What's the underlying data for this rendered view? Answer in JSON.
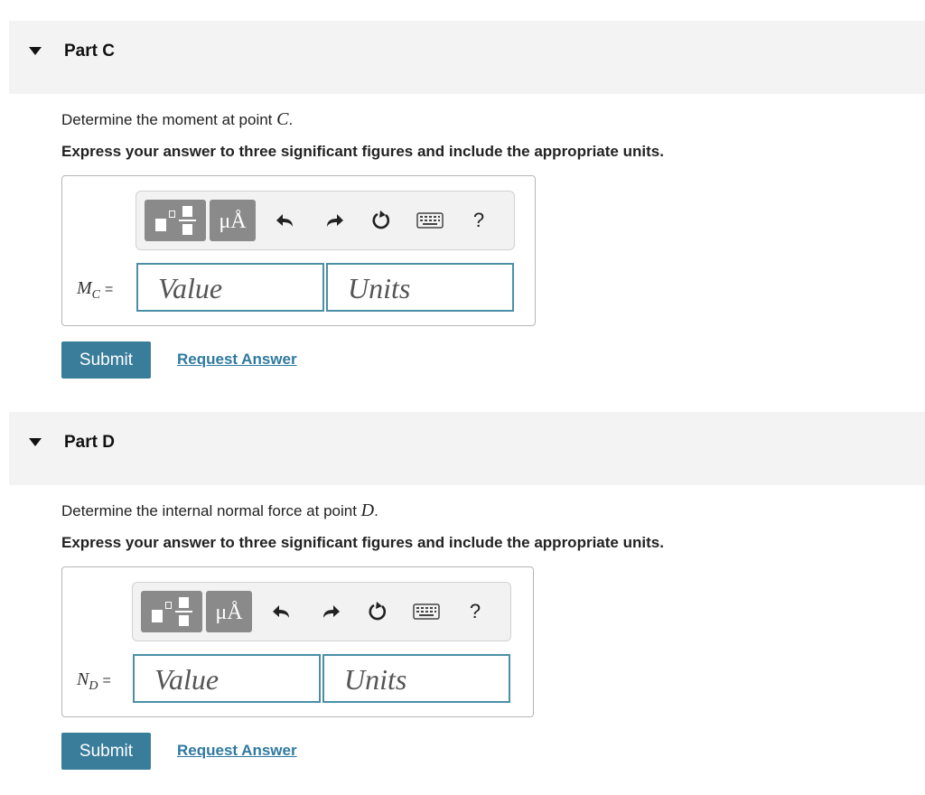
{
  "parts": [
    {
      "header": "Part C",
      "prompt_prefix": "Determine the moment at point ",
      "prompt_var": "C",
      "prompt_suffix": ".",
      "instructions": "Express your answer to three significant figures and include the appropriate units.",
      "var_main": "M",
      "var_sub": "C",
      "equals": "=",
      "value_placeholder": "Value",
      "units_placeholder": "Units",
      "units_button": "μÅ",
      "help_label": "?",
      "submit_label": "Submit",
      "request_label": "Request Answer"
    },
    {
      "header": "Part D",
      "prompt_prefix": "Determine the internal normal force at point ",
      "prompt_var": "D",
      "prompt_suffix": ".",
      "instructions": "Express your answer to three significant figures and include the appropriate units.",
      "var_main": "N",
      "var_sub": "D",
      "equals": "=",
      "value_placeholder": "Value",
      "units_placeholder": "Units",
      "units_button": "μÅ",
      "help_label": "?",
      "submit_label": "Submit",
      "request_label": "Request Answer"
    }
  ],
  "icons": [
    "caret-down-icon",
    "templates-icon",
    "undo-icon",
    "redo-icon",
    "reset-icon",
    "keyboard-icon",
    "help-icon"
  ],
  "colors": {
    "accent": "#3a7d9a",
    "link": "#2f7aa0",
    "field_border": "#4a8fa6",
    "header_bg": "#f3f3f3"
  }
}
